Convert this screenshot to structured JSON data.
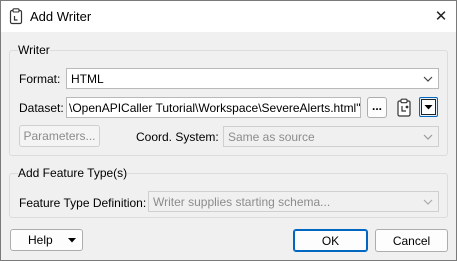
{
  "window": {
    "title": "Add Writer",
    "close_glyph": "✕"
  },
  "writer_group": {
    "title": "Writer",
    "format_label": "Format:",
    "format_value": "HTML",
    "dataset_label": "Dataset:",
    "dataset_value": "\\OpenAPICaller Tutorial\\Workspace\\SevereAlerts.html\"",
    "browse_label": "...",
    "parameters_label": "Parameters...",
    "coord_label": "Coord. System:",
    "coord_value": "Same as source"
  },
  "feature_group": {
    "title": "Add Feature Type(s)",
    "definition_label": "Feature Type Definition:",
    "definition_value": "Writer supplies starting schema..."
  },
  "footer": {
    "help_label": "Help",
    "ok_label": "OK",
    "cancel_label": "Cancel"
  },
  "icons": {
    "title": "writer-icon",
    "clear": "clipboard-icon",
    "dropdown": "dropdown-arrow-icon",
    "chevron": "chevron-down-icon"
  },
  "colors": {
    "accent": "#0067c0"
  }
}
